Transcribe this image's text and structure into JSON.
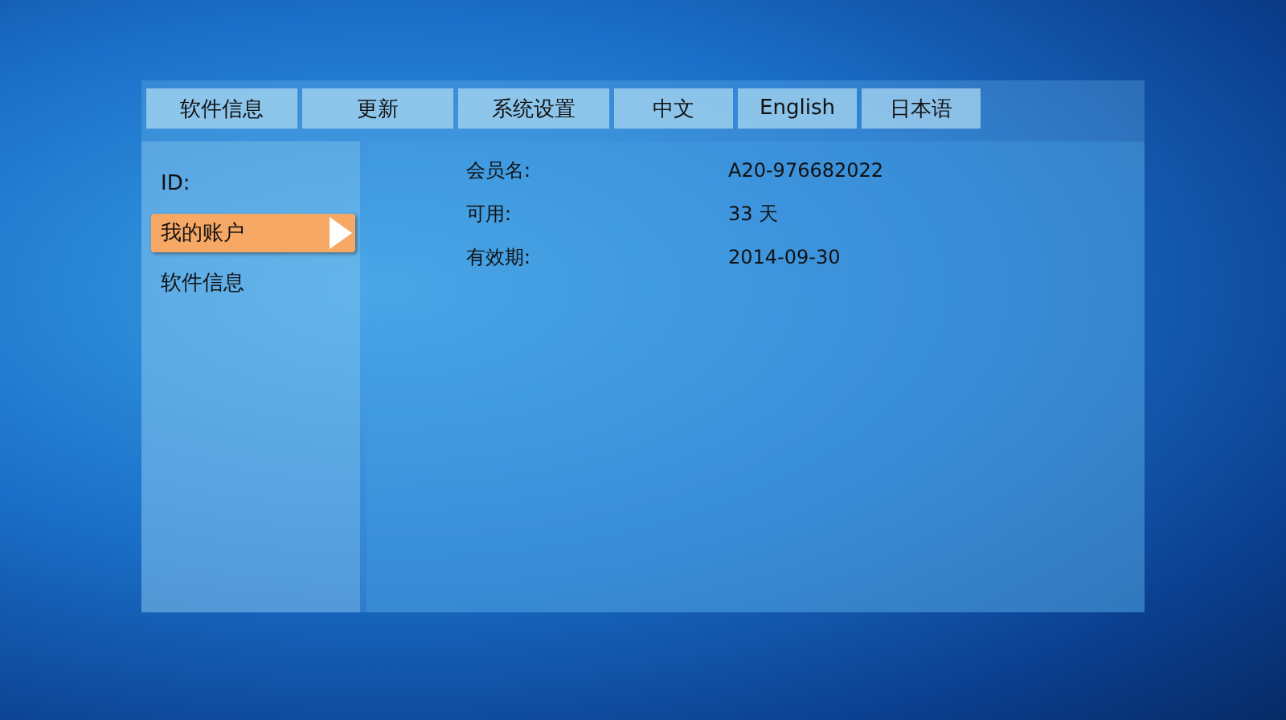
{
  "tabs": [
    {
      "label": "软件信息",
      "selected": false
    },
    {
      "label": "更新",
      "selected": false
    },
    {
      "label": "系统设置",
      "selected": false
    },
    {
      "label": "中文",
      "selected": false
    },
    {
      "label": "English",
      "selected": false
    },
    {
      "label": "日本语",
      "selected": false
    }
  ],
  "sidebar": {
    "items": [
      {
        "label": "ID:",
        "selected": false
      },
      {
        "label": "我的账户",
        "selected": true
      },
      {
        "label": "软件信息",
        "selected": false
      }
    ]
  },
  "account": [
    {
      "label": "会员名:",
      "value": "A20-976682022"
    },
    {
      "label": "可用:",
      "value": "33 天"
    },
    {
      "label": "有效期:",
      "value": "2014-09-30"
    }
  ]
}
